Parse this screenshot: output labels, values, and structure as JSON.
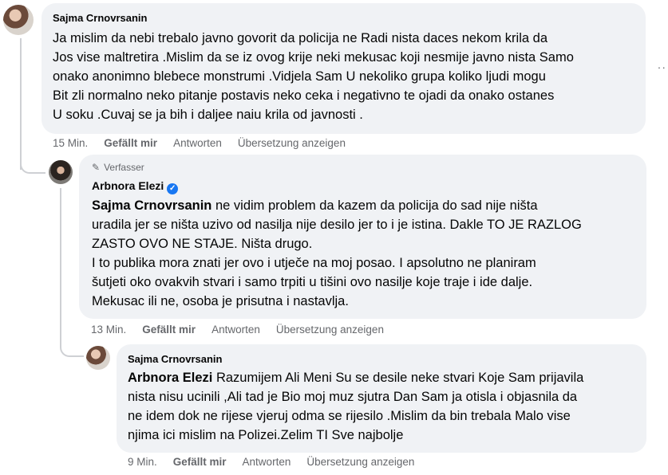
{
  "comments": [
    {
      "author": "Sajma Crnovrsanin",
      "mention": "",
      "text": "Ja mislim da nebi trebalo javno govorit da policija ne Radi nista daces nekom krila da\nJos vise maltretira .Mislim da se iz ovog krije neki mekusac koji nesmije javno nista Samo\nonako anonimno blebece monstrumi .Vidjela Sam U nekoliko grupa koliko ljudi mogu\nBit zli normalno neko pitanje postavis neko ceka i negativno te ojadi da onako ostanes\nU soku .Cuvaj se ja bih i daljee naiu krila od javnosti .",
      "time": "15 Min.",
      "like": "Gefällt mir",
      "reply": "Antworten",
      "translate": "Übersetzung anzeigen"
    },
    {
      "author_tag": "Verfasser",
      "author": "Arbnora Elezi",
      "mention": "Sajma Crnovrsanin",
      "text": " ne vidim problem da kazem da policija do sad nije ništa\nuradila jer se ništa uzivo od nasilja nije desilo jer to i je istina. Dakle TO JE RAZLOG\nZASTO OVO NE STAJE. Ništa drugo.\nI to publika mora znati jer ovo i utječe na moj posao. I apsolutno ne planiram\nšutjeti oko ovakvih stvari i samo trpiti u tišini ovo nasilje koje traje i ide dalje.\nMekusac ili ne, osoba je prisutna i nastavlja.",
      "time": "13 Min.",
      "like": "Gefällt mir",
      "reply": "Antworten",
      "translate": "Übersetzung anzeigen"
    },
    {
      "author": "Sajma Crnovrsanin",
      "mention": "Arbnora Elezi",
      "text": " Razumijem Ali Meni Su se desile neke stvari Koje Sam prijavila\nnista nisu ucinili ,Ali tad je Bio moj muz sjutra Dan Sam ja otisla i objasnila da\nne idem dok ne rijese vjeruj odma se rijesilo .Mislim da bin trebala Malo vise\nnjima ici mislim na Polizei.Zelim TI Sve najbolje",
      "time": "9 Min.",
      "like": "Gefällt mir",
      "reply": "Antworten",
      "translate": "Übersetzung anzeigen"
    }
  ],
  "more_glyph": "··",
  "verified_glyph": "✓",
  "pencil_glyph": "✎"
}
